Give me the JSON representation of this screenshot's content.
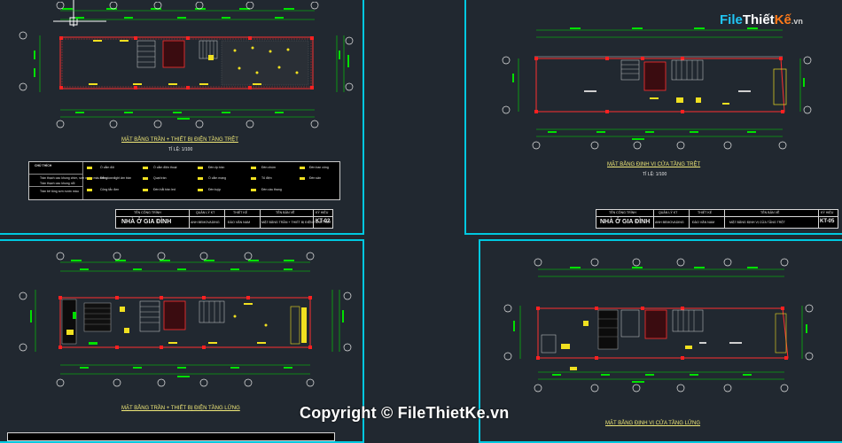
{
  "logo": {
    "part1": "File",
    "part2": "Thiết",
    "part3": "Kế",
    "part4": ".vn"
  },
  "watermark": "Copyright © FileThietKe.vn",
  "sheets": [
    {
      "id": "kt02",
      "title": "MẶT BẰNG TRẦN + THIẾT BỊ ĐIỆN TẦNG TRỆT",
      "scale": "TỈ LỆ: 1/100"
    },
    {
      "id": "kt05",
      "title": "MẶT BẰNG ĐỊNH VỊ CỬA TẦNG TRỆT",
      "scale": "TỈ LỆ: 1/100"
    },
    {
      "id": "kt03",
      "title": "MẶT BẰNG TRẦN + THIẾT BỊ ĐIỆN TẦNG LỬNG",
      "scale": ""
    },
    {
      "id": "kt06",
      "title": "MẶT BẰNG ĐỊNH VỊ CỬA TẦNG LỬNG",
      "scale": ""
    }
  ],
  "title_blocks": [
    {
      "headers": [
        "TÊN CÔNG TRÌNH",
        "QUẢN LÝ KT",
        "THIẾT KẾ",
        "TÊN BẢN VẼ",
        "KÝ HIỆU"
      ],
      "project": "NHÀ Ở GIA ĐÌNH",
      "manager": "ANH BEMOVADING",
      "designer": "ĐÀO VĂN NAM",
      "drawing": "MẶT BẰNG TRẦN + THIẾT BỊ ĐIỆN TẦNG TRỆT",
      "code": "KT-02"
    },
    {
      "headers": [
        "TÊN CÔNG TRÌNH",
        "QUẢN LÝ KT",
        "THIẾT KẾ",
        "TÊN BẢN VẼ",
        "KÝ HIỆU"
      ],
      "project": "NHÀ Ở GIA ĐÌNH",
      "manager": "ANH BEMOVADING",
      "designer": "ĐÀO VĂN NAM",
      "drawing": "MẶT BẰNG ĐỊNH VỊ CỬA TẦNG TRỆT",
      "code": "KT-05"
    }
  ],
  "legend": {
    "heading": "CHÚ THÍCH",
    "left_items": [
      "Trần thạch cao khung chìm, sơn nước màu trắng",
      "Trần thạch cao khung nổi",
      "Trần bê tông sơn nước màu"
    ],
    "items": [
      "Ổ cắm đôi",
      "Đèn downlight âm trần",
      "Công tắc đơn",
      "Ổ cắm điện thoại",
      "Quạt trần",
      "Đèn hắt trần led",
      "Đèn ốp trần",
      "Ổ cắm mạng",
      "Đèn tuýp",
      "Đèn chùm",
      "Tủ điện",
      "Đèn cầu thang",
      "Đèn ban công",
      "Đèn sân"
    ]
  },
  "colors": {
    "background": "#212830",
    "sheet_border": "#00c8e0",
    "dim_lines": "#00e000",
    "walls": "#ff3030",
    "text_yellow": "#f0e878"
  }
}
